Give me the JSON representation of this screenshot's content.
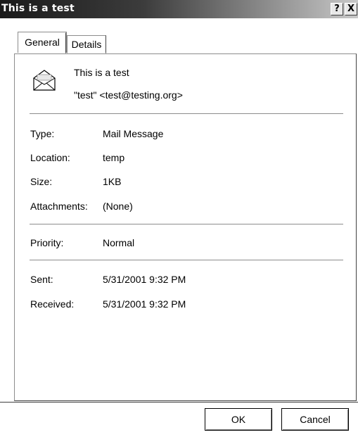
{
  "window": {
    "title": "This is a test",
    "help_glyph": "?",
    "close_glyph": "X"
  },
  "tabs": [
    {
      "label": "General",
      "selected": true
    },
    {
      "label": "Details",
      "selected": false
    }
  ],
  "header": {
    "icon": "envelope-icon",
    "subject": "This is a test",
    "from": "\"test\" <test@testing.org>"
  },
  "properties": {
    "type": {
      "label": "Type:",
      "value": "Mail Message"
    },
    "location": {
      "label": "Location:",
      "value": "temp"
    },
    "size": {
      "label": "Size:",
      "value": "1KB"
    },
    "attachments": {
      "label": "Attachments:",
      "value": "(None)"
    },
    "priority": {
      "label": "Priority:",
      "value": "Normal"
    },
    "sent": {
      "label": "Sent:",
      "value": "5/31/2001 9:32 PM"
    },
    "received": {
      "label": "Received:",
      "value": "5/31/2001 9:32 PM"
    }
  },
  "buttons": {
    "ok": "OK",
    "cancel": "Cancel"
  },
  "colors": {
    "titlebar_start": "#1a1a1a",
    "titlebar_end": "#c8c8c8",
    "background": "#ffffff"
  }
}
